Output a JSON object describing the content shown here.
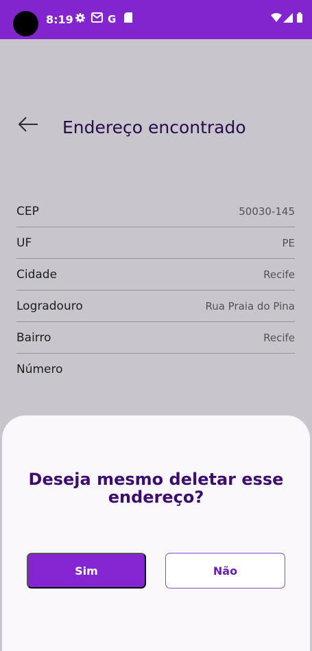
{
  "status_bar": {
    "time": "8:19",
    "icons": [
      "gear-icon",
      "gmail-icon",
      "google-icon",
      "sd-card-icon",
      "wifi-icon",
      "signal-icon",
      "battery-icon"
    ]
  },
  "header": {
    "title": "Endereço encontrado",
    "back_icon": "arrow-left-icon"
  },
  "address": {
    "rows": [
      {
        "label": "CEP",
        "value": "50030-145"
      },
      {
        "label": "UF",
        "value": "PE"
      },
      {
        "label": "Cidade",
        "value": "Recife"
      },
      {
        "label": "Logradouro",
        "value": "Rua Praia do Pina"
      },
      {
        "label": "Bairro",
        "value": "Recife"
      },
      {
        "label": "Número",
        "value": ""
      }
    ]
  },
  "dialog": {
    "question_line1": "Deseja mesmo deletar esse",
    "question_line2": "endereço?",
    "yes_label": "Sim",
    "no_label": "Não"
  },
  "colors": {
    "primary": "#8325cf",
    "title": "#2b0c5c",
    "question": "#3d0d6e"
  }
}
